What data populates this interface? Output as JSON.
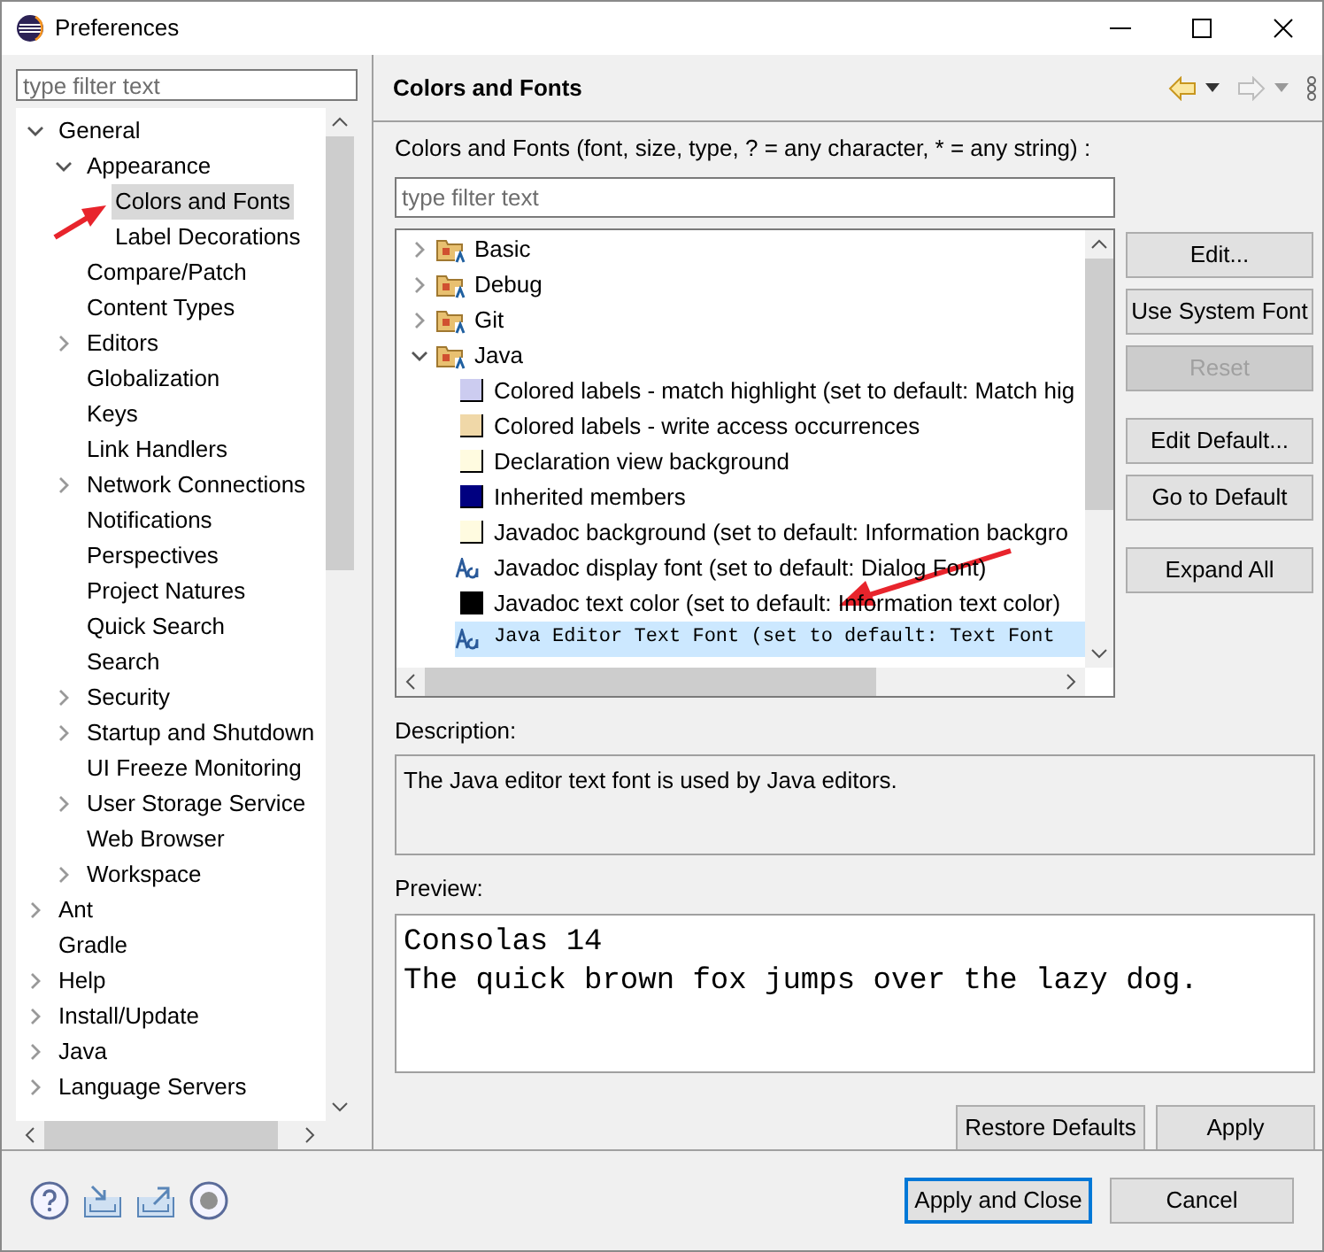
{
  "window": {
    "title": "Preferences"
  },
  "nav": {
    "filter": {
      "placeholder": "type filter text"
    },
    "tree": [
      {
        "label": "General",
        "expanded": true,
        "selected": false,
        "children": [
          {
            "label": "Appearance",
            "expanded": true,
            "selected": false,
            "children": [
              {
                "label": "Colors and Fonts",
                "selected": true
              },
              {
                "label": "Label Decorations",
                "selected": false
              }
            ]
          },
          {
            "label": "Compare/Patch",
            "selected": false
          },
          {
            "label": "Content Types",
            "selected": false
          },
          {
            "label": "Editors",
            "expanded": false,
            "selected": false
          },
          {
            "label": "Globalization",
            "selected": false
          },
          {
            "label": "Keys",
            "selected": false
          },
          {
            "label": "Link Handlers",
            "selected": false
          },
          {
            "label": "Network Connections",
            "expanded": false,
            "selected": false
          },
          {
            "label": "Notifications",
            "selected": false
          },
          {
            "label": "Perspectives",
            "selected": false
          },
          {
            "label": "Project Natures",
            "selected": false
          },
          {
            "label": "Quick Search",
            "selected": false
          },
          {
            "label": "Search",
            "selected": false
          },
          {
            "label": "Security",
            "expanded": false,
            "selected": false
          },
          {
            "label": "Startup and Shutdown",
            "expanded": false,
            "selected": false
          },
          {
            "label": "UI Freeze Monitoring",
            "selected": false
          },
          {
            "label": "User Storage Service",
            "expanded": false,
            "selected": false
          },
          {
            "label": "Web Browser",
            "selected": false
          },
          {
            "label": "Workspace",
            "expanded": false,
            "selected": false
          }
        ]
      },
      {
        "label": "Ant",
        "expanded": false,
        "selected": false
      },
      {
        "label": "Gradle",
        "selected": false
      },
      {
        "label": "Help",
        "expanded": false,
        "selected": false
      },
      {
        "label": "Install/Update",
        "expanded": false,
        "selected": false
      },
      {
        "label": "Java",
        "expanded": false,
        "selected": false
      },
      {
        "label": "Language Servers",
        "expanded": false,
        "selected": false
      }
    ]
  },
  "page": {
    "title": "Colors and Fonts",
    "intro": "Colors and Fonts (font, size, type, ? = any character, * = any string) :",
    "filter": {
      "placeholder": "type filter text"
    },
    "tree": [
      {
        "kind": "category",
        "label": "Basic",
        "expanded": false,
        "selected": false
      },
      {
        "kind": "category",
        "label": "Debug",
        "expanded": false,
        "selected": false
      },
      {
        "kind": "category",
        "label": "Git",
        "expanded": false,
        "selected": false
      },
      {
        "kind": "category",
        "label": "Java",
        "expanded": true,
        "selected": false,
        "children": [
          {
            "kind": "color",
            "color": "#ccccf0",
            "label": "Colored labels - match highlight (set to default: Match hig",
            "selected": false
          },
          {
            "kind": "color",
            "color": "#f0d8a8",
            "label": "Colored labels - write access occurrences",
            "selected": false
          },
          {
            "kind": "color",
            "color": "#fffbe0",
            "label": "Declaration view background",
            "selected": false
          },
          {
            "kind": "color",
            "color": "#000080",
            "label": "Inherited members",
            "selected": false
          },
          {
            "kind": "color",
            "color": "#fffbe0",
            "label": "Javadoc background (set to default: Information backgro",
            "selected": false
          },
          {
            "kind": "font",
            "label": "Javadoc display font (set to default: Dialog Font)",
            "selected": false
          },
          {
            "kind": "color",
            "color": "#000000",
            "label": "Javadoc text color (set to default: Information text color)",
            "selected": false
          },
          {
            "kind": "mono-font",
            "label": "Java Editor Text Font (set to default: Text Font",
            "selected": true
          }
        ]
      }
    ],
    "buttons": [
      {
        "label": "Edit...",
        "disabled": false
      },
      {
        "label": "Use System Font",
        "disabled": false
      },
      {
        "label": "Reset",
        "disabled": true
      },
      {
        "label": "Edit Default...",
        "disabled": false
      },
      {
        "label": "Go to Default",
        "disabled": false
      },
      {
        "label": "Expand All",
        "disabled": false
      }
    ],
    "description_label": "Description:",
    "description": "The Java editor text font is used by Java editors.",
    "preview_label": "Preview:",
    "preview": [
      "Consolas 14",
      "The quick brown fox jumps over the lazy dog."
    ],
    "restore_button": "Restore Defaults",
    "apply_button": "Apply"
  },
  "footer": {
    "buttons": [
      {
        "label": "Apply and Close",
        "selected": true
      },
      {
        "label": "Cancel",
        "selected": false
      }
    ]
  }
}
